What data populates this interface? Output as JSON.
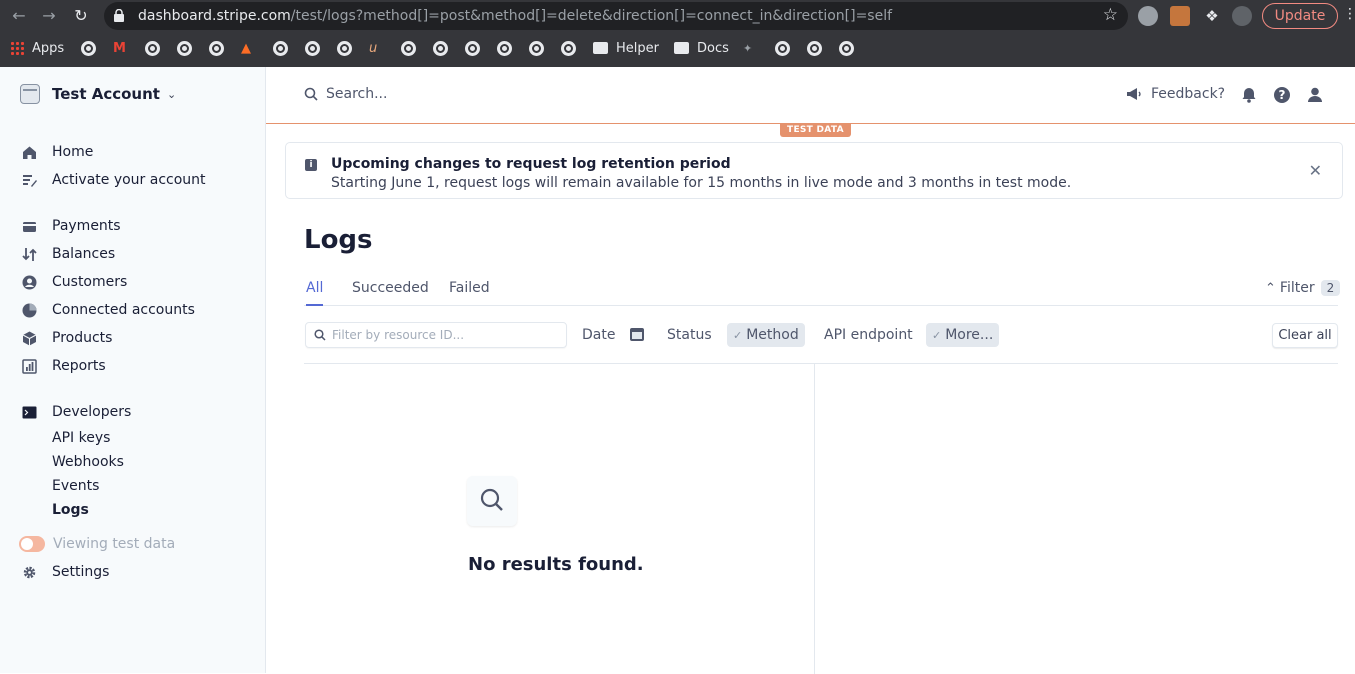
{
  "browser": {
    "url_host": "dashboard.stripe.com",
    "url_path": "/test/logs?method[]=post&method[]=delete&direction[]=connect_in&direction[]=self",
    "update_label": "Update",
    "bookmarks": {
      "apps": "Apps",
      "helper": "Helper",
      "docs": "Docs"
    }
  },
  "sidebar": {
    "account_name": "Test Account",
    "items": [
      {
        "label": "Home",
        "icon": "home-icon"
      },
      {
        "label": "Activate your account",
        "icon": "activate-icon"
      },
      {
        "label": "Payments",
        "icon": "payments-icon"
      },
      {
        "label": "Balances",
        "icon": "balances-icon"
      },
      {
        "label": "Customers",
        "icon": "customers-icon"
      },
      {
        "label": "Connected accounts",
        "icon": "connected-accounts-icon"
      },
      {
        "label": "Products",
        "icon": "products-icon"
      },
      {
        "label": "Reports",
        "icon": "reports-icon"
      },
      {
        "label": "Developers",
        "icon": "terminal-icon"
      }
    ],
    "developer_subitems": [
      "API keys",
      "Webhooks",
      "Events",
      "Logs"
    ],
    "active_subitem": "Logs",
    "test_toggle_label": "Viewing test data",
    "settings_label": "Settings"
  },
  "header": {
    "search_label": "Search...",
    "feedback_label": "Feedback?",
    "test_badge": "TEST DATA"
  },
  "banner": {
    "title": "Upcoming changes to request log retention period",
    "text": "Starting June 1, request logs will remain available for 15 months in live mode and 3 months in test mode."
  },
  "page": {
    "title": "Logs",
    "tabs": [
      "All",
      "Succeeded",
      "Failed"
    ],
    "active_tab": "All",
    "filter_label": "Filter",
    "filter_count": "2"
  },
  "filters": {
    "resource_placeholder": "Filter by resource ID...",
    "chips": [
      {
        "label": "Date",
        "applied": false
      },
      {
        "label": "Status",
        "applied": false
      },
      {
        "label": "Method",
        "applied": true
      },
      {
        "label": "API endpoint",
        "applied": false
      },
      {
        "label": "More...",
        "applied": true
      }
    ],
    "clear_all": "Clear all"
  },
  "results": {
    "empty_text": "No results found."
  },
  "colors": {
    "accent": "#5469d4",
    "test_mode": "#e5926d",
    "sidebar_bg": "#f7fafc"
  }
}
